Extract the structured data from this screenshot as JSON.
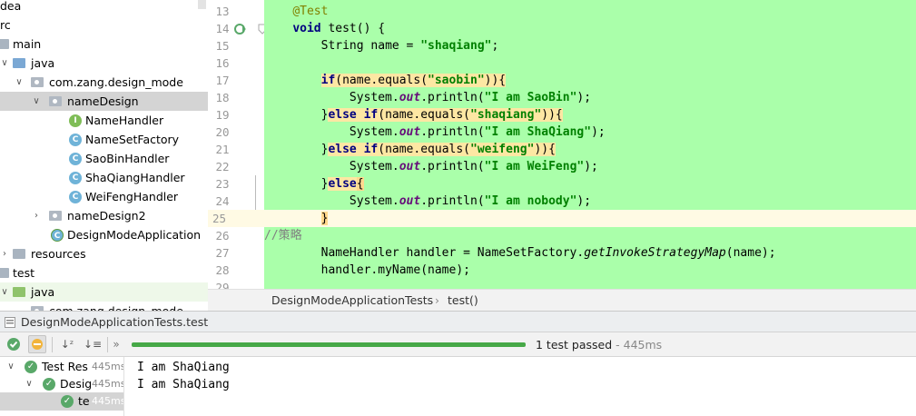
{
  "tree": {
    "items": [
      {
        "label": "dea"
      },
      {
        "label": "rc"
      },
      {
        "label": "main"
      },
      {
        "label": "java"
      },
      {
        "label": "com.zang.design_mode"
      },
      {
        "label": "nameDesign"
      },
      {
        "label": "NameHandler",
        "icon": "I"
      },
      {
        "label": "NameSetFactory",
        "icon": "C"
      },
      {
        "label": "SaoBinHandler",
        "icon": "C"
      },
      {
        "label": "ShaQiangHandler",
        "icon": "C"
      },
      {
        "label": "WeiFengHandler",
        "icon": "C"
      },
      {
        "label": "nameDesign2"
      },
      {
        "label": "DesignModeApplication",
        "icon": "C"
      },
      {
        "label": "resources"
      },
      {
        "label": "test"
      },
      {
        "label": "java"
      },
      {
        "label": "com.zang.design_mode"
      }
    ]
  },
  "editor": {
    "line_numbers": [
      "13",
      "14",
      "15",
      "16",
      "17",
      "18",
      "19",
      "20",
      "21",
      "22",
      "23",
      "24",
      "25",
      "26",
      "27",
      "28",
      "29"
    ],
    "code": {
      "l13_ann": "@Test",
      "l14_kw": "void",
      "l14_rest": " test() {",
      "l15_a": "String name = ",
      "l15_str": "\"shaqiang\"",
      "l15_b": ";",
      "l17_kw": "if",
      "l17_a": "(name.equals(",
      "l17_str": "\"saobin\"",
      "l17_b": ")){",
      "l18_a": "System.",
      "l18_out": "out",
      "l18_b": ".println(",
      "l18_str": "\"I am SaoBin\"",
      "l18_c": ");",
      "l19_a": "}",
      "l19_kw": "else if",
      "l19_b": "(name.equals(",
      "l19_str": "\"shaqiang\"",
      "l19_c": ")){",
      "l20_a": "System.",
      "l20_out": "out",
      "l20_b": ".println(",
      "l20_str": "\"I am ShaQiang\"",
      "l20_c": ");",
      "l21_a": "}",
      "l21_kw": "else if",
      "l21_b": "(name.equals(",
      "l21_str": "\"weifeng\"",
      "l21_c": ")){",
      "l22_a": "System.",
      "l22_out": "out",
      "l22_b": ".println(",
      "l22_str": "\"I am WeiFeng\"",
      "l22_c": ");",
      "l23_a": "}",
      "l23_kw": "else",
      "l23_b": "{",
      "l24_a": "System.",
      "l24_out": "out",
      "l24_b": ".println(",
      "l24_str": "\"I am nobody\"",
      "l24_c": ");",
      "l25_a": "}",
      "l26_cmt": "//策略",
      "l27_a": "NameHandler handler = NameSetFactory.",
      "l27_it": "getInvokeStrategyMap",
      "l27_b": "(name);",
      "l28_a": "handler.myName(name);"
    }
  },
  "breadcrumb": {
    "class": "DesignModeApplicationTests",
    "sep": "›",
    "method": "test()"
  },
  "run": {
    "title": "DesignModeApplicationTests.test",
    "status": "1 test passed",
    "duration": " - 445ms",
    "progress_fraction": 1.0,
    "results": [
      {
        "label": "Test Res",
        "time": "445ms"
      },
      {
        "label": "Desig",
        "time": "445ms"
      },
      {
        "label": "te",
        "time": "445ms"
      }
    ],
    "console": [
      "I am ShaQiang",
      "I am ShaQiang"
    ]
  },
  "colors": {
    "editor_bg": "#aaffaa",
    "current_line": "#fffae4",
    "progress": "#46a847",
    "keyword": "#000080",
    "string": "#008000"
  }
}
